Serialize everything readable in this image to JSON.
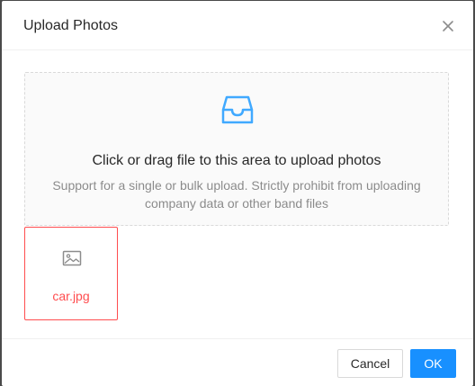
{
  "modal": {
    "title": "Upload Photos"
  },
  "dropzone": {
    "text": "Click or drag file to this area to upload photos",
    "hint": "Support for a single or bulk upload. Strictly prohibit from uploading company data or other band files",
    "icon": "inbox-icon"
  },
  "files": [
    {
      "name": "car.jpg",
      "status": "error",
      "icon": "picture-icon"
    }
  ],
  "footer": {
    "cancel_label": "Cancel",
    "ok_label": "OK"
  },
  "colors": {
    "primary": "#1890ff",
    "error": "#ff4d4f",
    "border": "#d9d9d9",
    "dropzone_bg": "#fafafa"
  }
}
